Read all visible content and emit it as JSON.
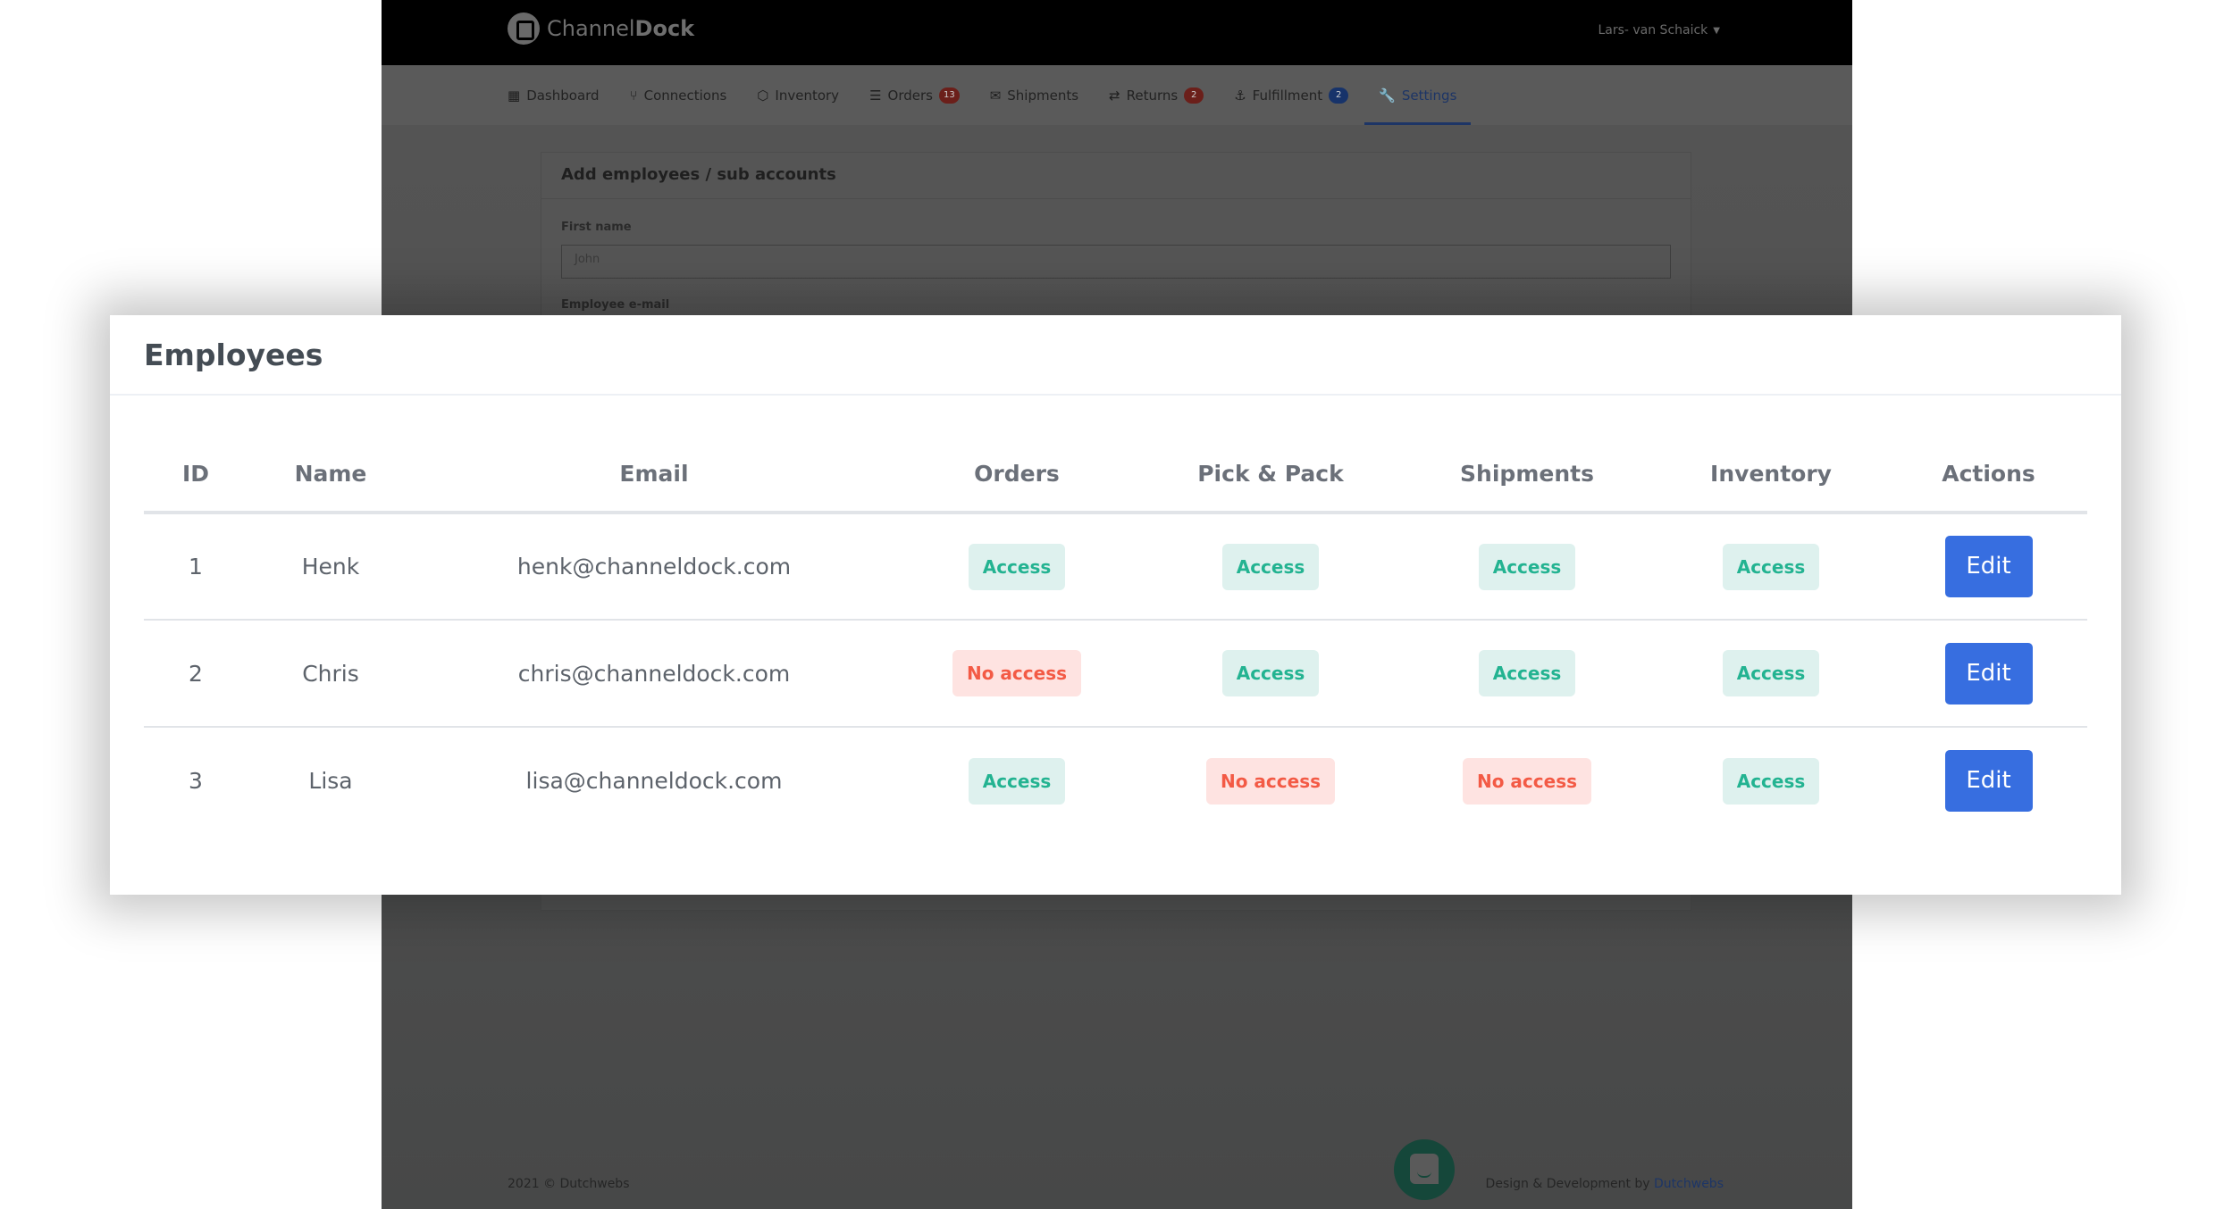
{
  "app": {
    "brand_light": "Channel",
    "brand_bold": "Dock",
    "user_name": "Lars- van Schaick",
    "nav": [
      {
        "label": "Dashboard",
        "icon": "dashboard-icon",
        "glyph": "▦",
        "badge": null
      },
      {
        "label": "Connections",
        "icon": "connections-icon",
        "glyph": "⑂",
        "badge": null
      },
      {
        "label": "Inventory",
        "icon": "inventory-icon",
        "glyph": "⬡",
        "badge": null
      },
      {
        "label": "Orders",
        "icon": "orders-icon",
        "glyph": "☰",
        "badge": "13"
      },
      {
        "label": "Shipments",
        "icon": "shipments-icon",
        "glyph": "✉",
        "badge": null
      },
      {
        "label": "Returns",
        "icon": "returns-icon",
        "glyph": "⇄",
        "badge": "2"
      },
      {
        "label": "Fulfillment",
        "icon": "fulfillment-icon",
        "glyph": "⚓",
        "badge": "2"
      },
      {
        "label": "Settings",
        "icon": "settings-icon",
        "glyph": "🔧",
        "badge": null,
        "active": true
      }
    ],
    "add_card": {
      "title": "Add employees / sub accounts",
      "first_name_label": "First name",
      "first_name_placeholder": "John",
      "email_label": "Employee e-mail"
    },
    "footer": {
      "copyright": "2021 © Dutchwebs",
      "credit_prefix": "Design & Development by",
      "credit_link": "Dutchwebs"
    }
  },
  "modal": {
    "title": "Employees",
    "columns": [
      "ID",
      "Name",
      "Email",
      "Orders",
      "Pick & Pack",
      "Shipments",
      "Inventory",
      "Actions"
    ],
    "rows": [
      {
        "id": "1",
        "name": "Henk",
        "email": "henk@channeldock.com",
        "orders": "Access",
        "pick_pack": "Access",
        "shipments": "Access",
        "inventory": "Access",
        "action": "Edit"
      },
      {
        "id": "2",
        "name": "Chris",
        "email": "chris@channeldock.com",
        "orders": "No access",
        "pick_pack": "Access",
        "shipments": "Access",
        "inventory": "Access",
        "action": "Edit"
      },
      {
        "id": "3",
        "name": "Lisa",
        "email": "lisa@channeldock.com",
        "orders": "Access",
        "pick_pack": "No access",
        "shipments": "No access",
        "inventory": "Access",
        "action": "Edit"
      }
    ]
  },
  "colors": {
    "access_text": "#23b391",
    "access_bg": "#def1ee",
    "no_access_text": "#f35a45",
    "no_access_bg": "#fee3e1",
    "primary": "#376ee0"
  }
}
